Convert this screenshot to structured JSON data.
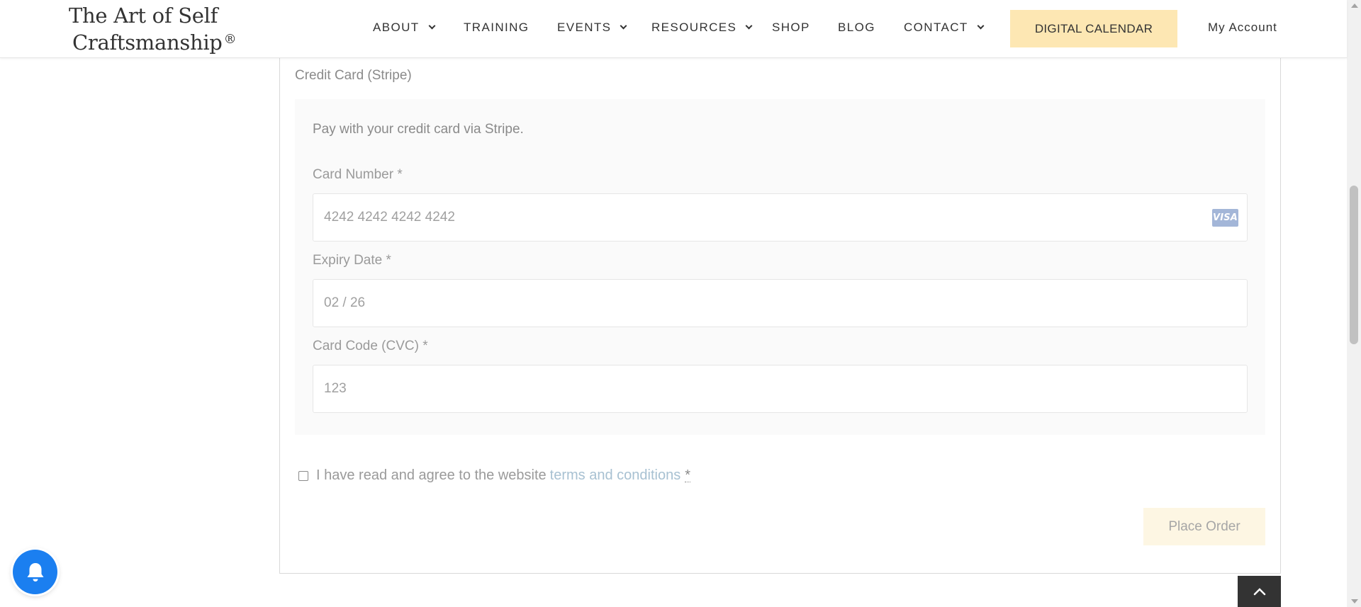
{
  "header": {
    "logo_line1": "The Art of Self",
    "logo_line2": "Craftsmanship",
    "logo_mark": "®",
    "nav": [
      {
        "label": "ABOUT",
        "has_dropdown": true
      },
      {
        "label": "TRAINING",
        "has_dropdown": false
      },
      {
        "label": "EVENTS",
        "has_dropdown": true
      },
      {
        "label": "RESOURCES",
        "has_dropdown": true
      },
      {
        "label": "SHOP",
        "has_dropdown": false
      },
      {
        "label": "BLOG",
        "has_dropdown": false
      },
      {
        "label": "CONTACT",
        "has_dropdown": true
      }
    ],
    "calendar_button": "DIGITAL CALENDAR",
    "account_link": "My Account"
  },
  "payment": {
    "method_label": "Credit Card (Stripe)",
    "description": "Pay with your credit card via Stripe.",
    "card_number": {
      "label": "Card Number *",
      "value": "4242 4242 4242 4242",
      "brand": "VISA"
    },
    "expiry": {
      "label": "Expiry Date *",
      "value": "02 / 26"
    },
    "cvc": {
      "label": "Card Code (CVC) *",
      "value": "123"
    }
  },
  "terms": {
    "text": "I have read and agree to the website",
    "link": "terms and conditions",
    "required_mark": "*",
    "checked": false
  },
  "actions": {
    "place_order": "Place Order"
  },
  "widgets": {
    "notification_icon": "bell-icon",
    "back_to_top_icon": "chevron-up-icon"
  },
  "colors": {
    "accent_button": "#fde7b3",
    "place_order_bg": "#fdf6e3",
    "notification_blue": "#1b7ff0",
    "link": "#a8c1d2"
  }
}
